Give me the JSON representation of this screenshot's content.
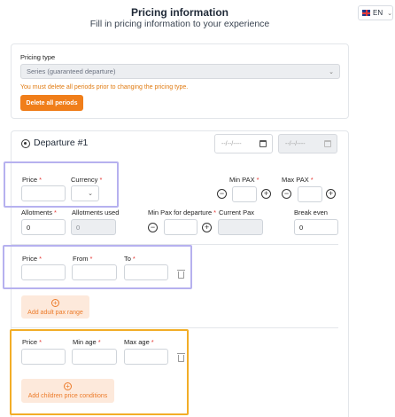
{
  "header": {
    "title": "Pricing information",
    "subtitle": "Fill in pricing information to your experience"
  },
  "language": {
    "code": "EN",
    "flag_icon": "uk-flag-icon"
  },
  "pricing_type": {
    "label": "Pricing type",
    "selected": "Series (guaranteed departure)",
    "warning": "You must delete all periods prior to changing the pricing type.",
    "delete_button": "Delete all periods"
  },
  "departure": {
    "title": "Departure #1",
    "start_date_placeholder": "--/--/----",
    "end_date_placeholder": "--/--/----",
    "price_label": "Price",
    "currency_label": "Currency",
    "min_pax_label": "Min PAX",
    "max_pax_label": "Max PAX",
    "allotments_label": "Allotments",
    "allotments_value": "0",
    "allotments_used_label": "Allotments used",
    "allotments_used_value": "0",
    "min_pax_departure_label": "Min Pax for departure",
    "current_pax_label": "Current Pax",
    "break_even_label": "Break even",
    "break_even_value": "0"
  },
  "adult_range": {
    "price_label": "Price",
    "from_label": "From",
    "to_label": "To",
    "add_button": "Add adult pax range"
  },
  "children": {
    "price_label": "Price",
    "min_age_label": "Min age",
    "max_age_label": "Max age",
    "add_button": "Add children price conditions"
  },
  "required_mark": "*",
  "colors": {
    "accent": "#f07e1a",
    "highlight_purple": "#b6b1ef",
    "highlight_orange": "#f2ad27",
    "required": "#e53935"
  }
}
